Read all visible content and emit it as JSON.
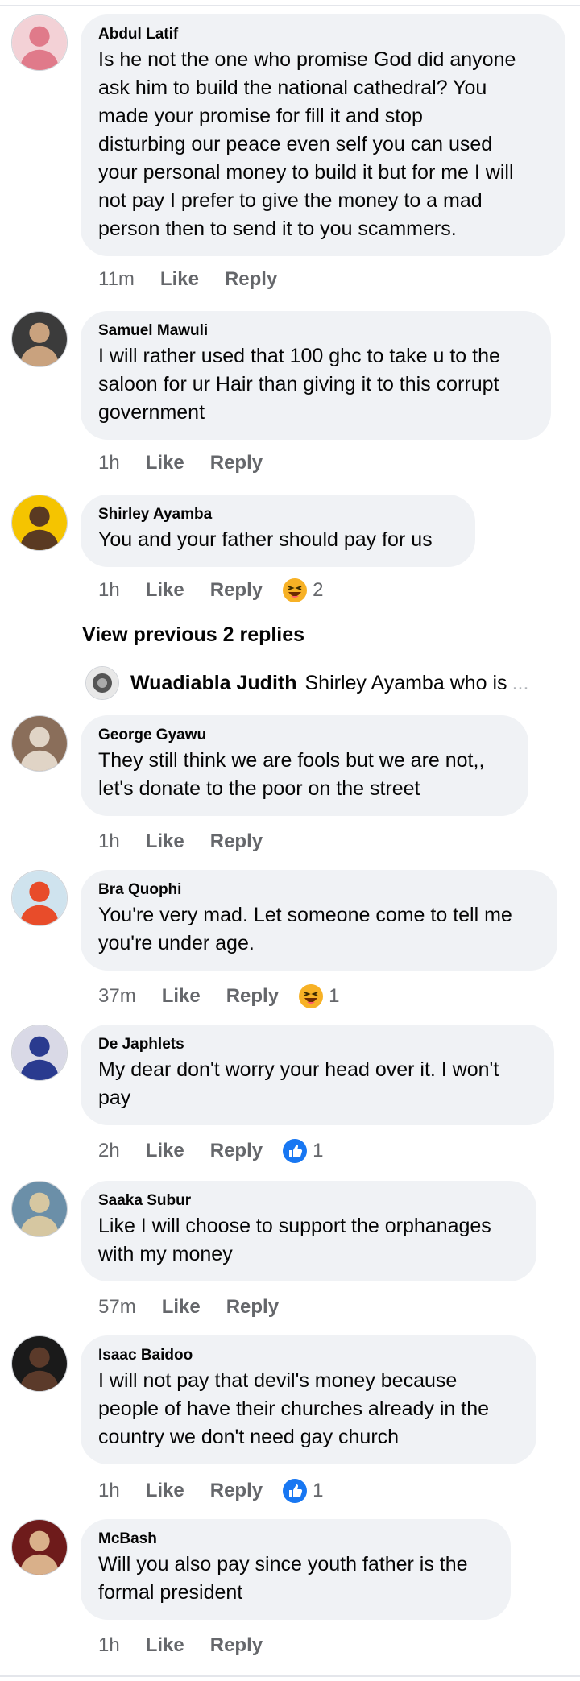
{
  "comments": [
    {
      "author": "Abdul Latif",
      "lines": [
        "Is he not the one who promise God did anyone",
        "ask him to build the national cathedral? You",
        "made your promise for fill it and stop",
        "disturbing our peace even self you can used",
        "your personal money to build it but for me I will",
        "not pay I prefer to give the money to a mad",
        "person then to send it to you scammers."
      ],
      "time": "11m",
      "like": "Like",
      "reply": "Reply"
    },
    {
      "author": "Samuel Mawuli",
      "lines": [
        "I will rather used that 100 ghc to take u to the",
        "saloon for ur Hair than giving it to this corrupt",
        "government"
      ],
      "time": "1h",
      "like": "Like",
      "reply": "Reply"
    },
    {
      "author": "Shirley Ayamba",
      "lines": [
        "You and your father should pay for us"
      ],
      "time": "1h",
      "like": "Like",
      "reply": "Reply",
      "reaction": {
        "icon": "haha-icon",
        "count": "2"
      }
    },
    {
      "author": "George Gyawu",
      "lines": [
        "They still think we are fools but we are not,,",
        "let's donate to the poor on the street"
      ],
      "time": "1h",
      "like": "Like",
      "reply": "Reply"
    },
    {
      "author": "Bra Quophi",
      "lines": [
        "You're very mad. Let someone come to tell me",
        "you're under age."
      ],
      "time": "37m",
      "like": "Like",
      "reply": "Reply",
      "reaction": {
        "icon": "haha-icon",
        "count": "1"
      }
    },
    {
      "author": "De Japhlets",
      "lines": [
        "My dear don't worry your head over it.   I won't",
        "pay"
      ],
      "time": "2h",
      "like": "Like",
      "reply": "Reply",
      "reaction": {
        "icon": "thumbs-up-icon",
        "count": "1"
      }
    },
    {
      "author": "Saaka Subur",
      "lines": [
        "Like I will choose to support the orphanages",
        "with my money"
      ],
      "time": "57m",
      "like": "Like",
      "reply": "Reply"
    },
    {
      "author": "Isaac Baidoo",
      "lines": [
        "I will not pay that devil's money because",
        "people of have their churches already in the",
        "country we don't need gay church"
      ],
      "time": "1h",
      "like": "Like",
      "reply": "Reply",
      "reaction": {
        "icon": "thumbs-up-icon",
        "count": "1"
      }
    },
    {
      "author": "McBash",
      "lines": [
        "Will you also pay since youth father is the",
        "formal president"
      ],
      "time": "1h",
      "like": "Like",
      "reply": "Reply"
    }
  ],
  "replies_thread": {
    "view_previous": "View previous 2 replies",
    "author": "Wuadiabla Judith",
    "snippet": "Shirley Ayamba who is",
    "ellipsis": "..."
  },
  "colors": {
    "bubble": "#f0f2f5",
    "meta": "#65676b",
    "like_blue": "#1877f2",
    "haha_yellow": "#f7b125"
  }
}
